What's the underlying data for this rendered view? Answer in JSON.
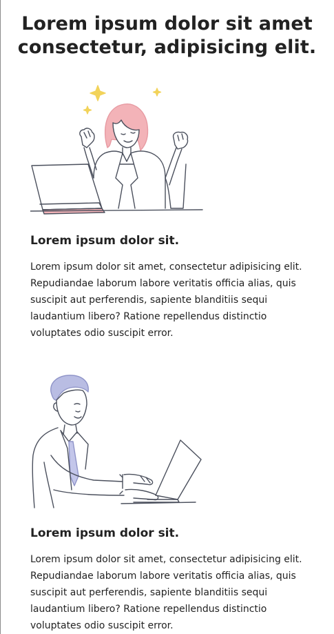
{
  "header": {
    "title": "Lorem ipsum dolor sit amet consectetur, adipisicing elit."
  },
  "sections": [
    {
      "illustration_icon": "woman-laptop-celebrating-illustration",
      "heading": "Lorem ipsum dolor sit.",
      "body": "Lorem ipsum dolor sit amet, consectetur adipisicing elit. Repudiandae laborum labore veritatis officia alias, quis suscipit aut perferendis, sapiente blanditiis sequi laudantium libero? Ratione repellendus distinctio voluptates odio suscipit error."
    },
    {
      "illustration_icon": "man-typing-laptop-illustration",
      "heading": "Lorem ipsum dolor sit.",
      "body": "Lorem ipsum dolor sit amet, consectetur adipisicing elit. Repudiandae laborum labore veritatis officia alias, quis suscipit aut perferendis, sapiente blanditiis sequi laudantium libero? Ratione repellendus distinctio voluptates odio suscipit error."
    }
  ],
  "colors": {
    "text": "#222222",
    "line_art": "#4a4f5c",
    "hair_pink": "#f3b3b8",
    "hair_lavender": "#b9bde3",
    "sparkle_yellow": "#f2d35a",
    "tie_lavender": "#c3c6ea"
  }
}
